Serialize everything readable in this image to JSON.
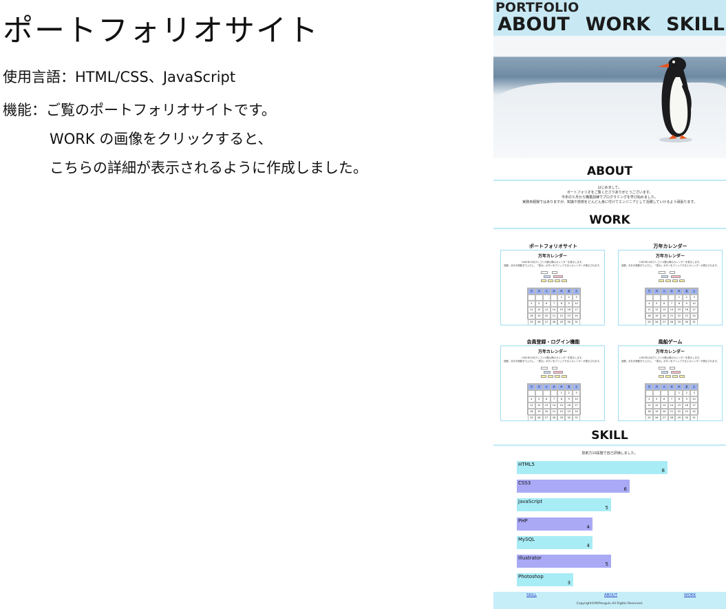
{
  "description": {
    "title": "ポートフォリオサイト",
    "lines": [
      "使用言語：HTML/CSS、JavaScript",
      "機能：ご覧のポートフォリオサイトです。",
      "WORK の画像をクリックすると、",
      "こちらの詳細が表示されるように作成しました。"
    ]
  },
  "preview": {
    "logo": "PORTFOLIO",
    "nav": [
      "ABOUT",
      "WORK",
      "SKILL"
    ],
    "about": {
      "heading": "ABOUT",
      "lines": [
        "はじめまして。",
        "ポートフォリオをご覧くださりありがとうございます。",
        "今年の５月から職業訓練でプログラミングを学び始めました。",
        "実務未経験ではありますが、知識や技術をどんどん身に付けてエンジニアとして活躍していけるよう頑張ります。"
      ]
    },
    "work": {
      "heading": "WORK",
      "items": [
        {
          "title": "ポートフォリオサイト",
          "card_title": "万年カレンダー"
        },
        {
          "title": "万年カレンダー",
          "card_title": "万年カレンダー"
        },
        {
          "title": "会員登録・ログイン機能",
          "card_title": "万年カレンダー"
        },
        {
          "title": "風船ゲーム",
          "card_title": "万年カレンダー"
        }
      ],
      "card_text": [
        "1582年10月グレゴリオ暦以降のカレンダーを表示します。",
        "西暦、月を半角数字で入力し、「表示」ボタンをクリックするとカレンダーが表示されます。"
      ],
      "weekdays": [
        "日",
        "月",
        "火",
        "水",
        "木",
        "金",
        "土"
      ],
      "days": [
        "",
        "",
        "",
        "",
        "1",
        "2",
        "3",
        "4",
        "5",
        "6",
        "7",
        "8",
        "9",
        "10",
        "11",
        "12",
        "13",
        "14",
        "15",
        "16",
        "17",
        "18",
        "19",
        "20",
        "21",
        "22",
        "23",
        "24",
        "25",
        "26",
        "27",
        "28",
        "29",
        "30",
        "31"
      ]
    },
    "skill": {
      "heading": "SKILL",
      "note": "技術力10段階で自己評価しました。",
      "items": [
        {
          "name": "HTML5",
          "level": 8,
          "color": "#a8ecf6"
        },
        {
          "name": "CSS3",
          "level": 6,
          "color": "#a9a9f6"
        },
        {
          "name": "JavaScript",
          "level": 5,
          "color": "#a8ecf6"
        },
        {
          "name": "PHP",
          "level": 4,
          "color": "#a9a9f6"
        },
        {
          "name": "MySQL",
          "level": 4,
          "color": "#a8ecf6"
        },
        {
          "name": "Illustrator",
          "level": 5,
          "color": "#a9a9f6"
        },
        {
          "name": "Photoshop",
          "level": 3,
          "color": "#a8ecf6"
        }
      ]
    },
    "footer": {
      "links": [
        "SKILL",
        "ABOUT",
        "WORK"
      ],
      "copyright": "Copyright©MrPenguin All Rights Reserved."
    }
  }
}
